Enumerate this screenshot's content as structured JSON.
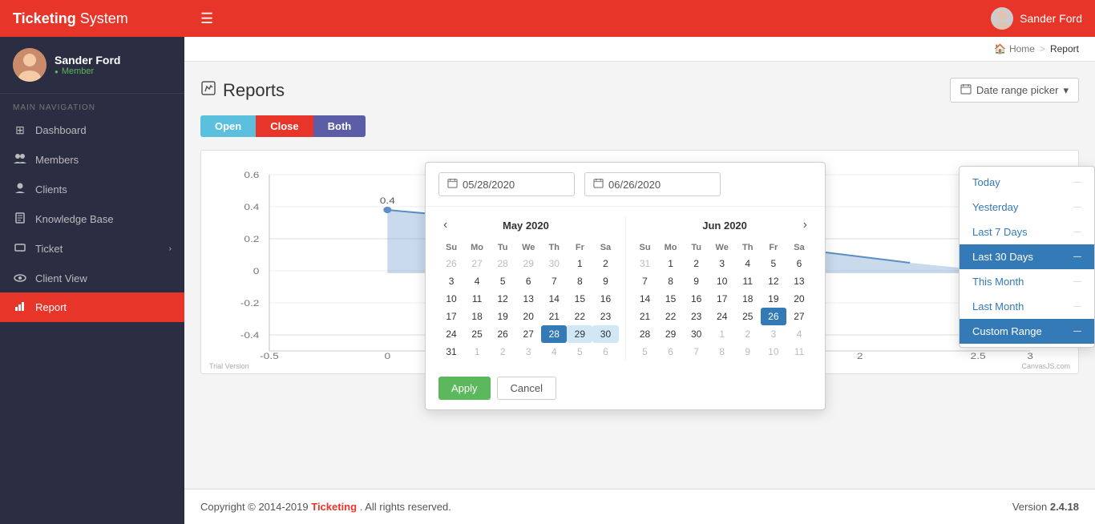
{
  "app": {
    "brand_normal": "Ticketing",
    "brand_bold": "System",
    "hamburger": "☰"
  },
  "topbar": {
    "user_name": "Sander Ford",
    "user_avatar_emoji": "👤"
  },
  "sidebar": {
    "profile": {
      "name": "Sander Ford",
      "role": "Member"
    },
    "nav_label": "MAIN NAVIGATION",
    "items": [
      {
        "id": "dashboard",
        "label": "Dashboard",
        "icon": "⊞"
      },
      {
        "id": "members",
        "label": "Members",
        "icon": "👥"
      },
      {
        "id": "clients",
        "label": "Clients",
        "icon": "👤"
      },
      {
        "id": "knowledge-base",
        "label": "Knowledge Base",
        "icon": "📖"
      },
      {
        "id": "ticket",
        "label": "Ticket",
        "icon": "🎫",
        "expand": "❯"
      },
      {
        "id": "client-view",
        "label": "Client View",
        "icon": "👁"
      },
      {
        "id": "report",
        "label": "Report",
        "icon": "📊",
        "active": true
      }
    ]
  },
  "breadcrumb": {
    "home_icon": "🏠",
    "home_label": "Home",
    "separator": ">",
    "current": "Report"
  },
  "page": {
    "title": "Reports",
    "title_icon": "✎"
  },
  "filter_buttons": {
    "open": "Open",
    "close": "Close",
    "both": "Both"
  },
  "date_range_btn": {
    "icon": "📅",
    "label": "Date range picker",
    "arrow": "▾"
  },
  "calendar": {
    "start_date": "05/28/2020",
    "end_date": "06/26/2020",
    "may": {
      "title": "May 2020",
      "days_header": [
        "Su",
        "Mo",
        "Tu",
        "We",
        "Th",
        "Fr",
        "Sa"
      ],
      "prev_icon": "‹",
      "next_icon": ""
    },
    "jun": {
      "title": "Jun 2020",
      "days_header": [
        "Su",
        "Mo",
        "Tu",
        "We",
        "Th",
        "Fr",
        "Sa"
      ],
      "prev_icon": "",
      "next_icon": "›"
    }
  },
  "date_range_options": {
    "today": "Today",
    "yesterday": "Yesterday",
    "last7": "Last 7 Days",
    "last30": "Last 30 Days",
    "this_month": "This Month",
    "last_month": "Last Month",
    "custom": "Custom Range",
    "apply": "Apply",
    "cancel": "Cancel"
  },
  "chart": {
    "watermark": "Trial Version",
    "canvasjs": "CanvasJS.com"
  },
  "footer": {
    "copyright": "Copyright © 2014-2019",
    "brand": "Ticketing",
    "rights": ". All rights reserved.",
    "version_label": "Version",
    "version_number": "2.4.18"
  }
}
